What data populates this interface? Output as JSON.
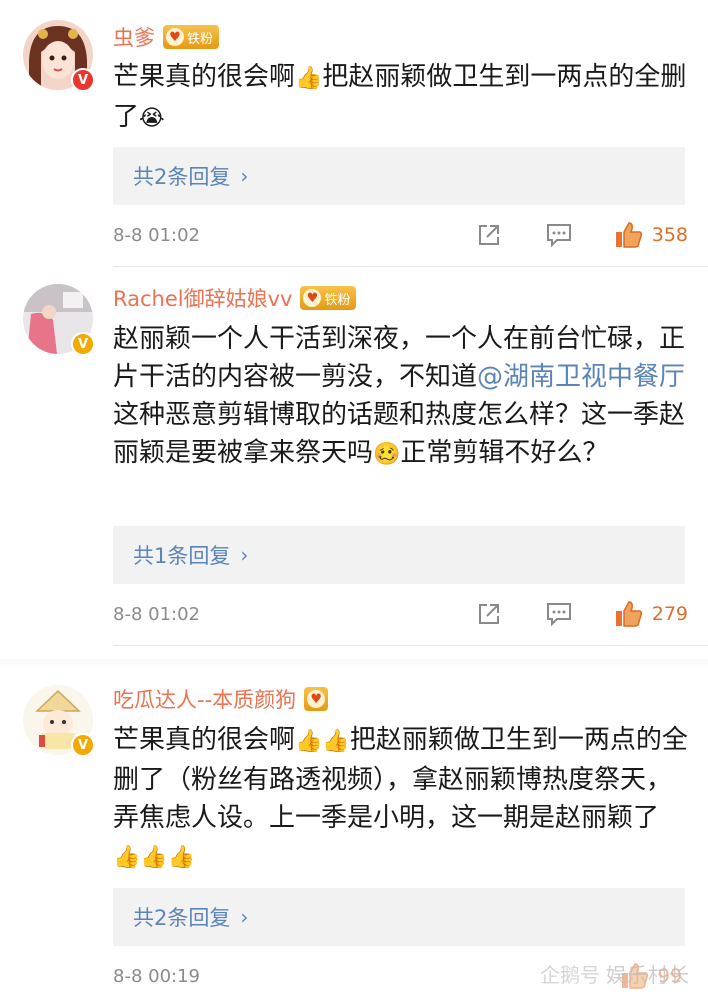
{
  "comments": [
    {
      "username": "虫爹",
      "fan_badge": "铁粉",
      "verified": "red",
      "content_parts": [
        "芒果真的很会啊",
        "👍",
        "把赵丽颖做卫生到一两点的全删了",
        "😭"
      ],
      "reply_label": "共2条回复",
      "timestamp": "8-8 01:02",
      "likes": "358"
    },
    {
      "username": "Rachel御辞姑娘vv",
      "fan_badge": "铁粉",
      "verified": "gold",
      "content_parts": [
        "赵丽颖一个人干活到深夜，一个人在前台忙碌，正片干活的内容被一剪没，不知道",
        "@湖南卫视中餐厅",
        " 这种恶意剪辑博取的话题和热度怎么样？这一季赵丽颖是要被拿来祭天吗",
        "🥴",
        "正常剪辑不好么？"
      ],
      "reply_label": "共1条回复",
      "timestamp": "8-8 01:02",
      "likes": "279"
    },
    {
      "username": "吃瓜达人--本质颜狗",
      "fan_badge": "",
      "verified": "gold",
      "content_parts": [
        "芒果真的很会啊",
        "👍👍",
        "把赵丽颖做卫生到一两点的全删了（粉丝有路透视频），拿赵丽颖博热度祭天，弄焦虑人设。上一季是小明，这一期是赵丽颖了",
        "👍👍👍"
      ],
      "reply_label": "共2条回复",
      "timestamp": "8-8 00:19",
      "likes": "99"
    }
  ],
  "icons": {
    "share": "share-icon",
    "comment": "comment-icon",
    "like": "thumbs-up-icon",
    "chevron": "›"
  },
  "colors": {
    "username": "#eb7350",
    "link": "#5b84b8",
    "like": "#e06c2a",
    "timestamp": "#8b8b8b"
  },
  "watermark": {
    "logo": "企鹅号",
    "text": "娱乐村长"
  }
}
